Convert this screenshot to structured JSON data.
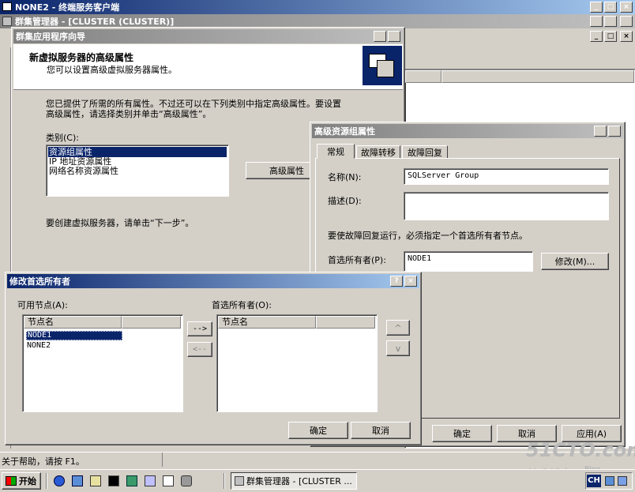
{
  "outer_window": {
    "title": "NONE2 - 终端服务客户端"
  },
  "cluster_admin": {
    "title": "群集管理器 - [CLUSTER (CLUSTER)]"
  },
  "wizard": {
    "title": "群集应用程序向导",
    "heading": "新虚拟服务器的高级属性",
    "subheading": "您可以设置高级虚拟服务器属性。",
    "intro_line1": "您已提供了所需的所有属性。不过还可以在下列类别中指定高级属性。要设置",
    "intro_line2": "高级属性，请选择类别并单击“高级属性”。",
    "category_label": "类别(C):",
    "categories": [
      "资源组属性",
      "IP 地址资源属性",
      "网络名称资源属性"
    ],
    "advanced_button": "高级属性",
    "footer_text": "要创建虚拟服务器，请单击“下一步”。"
  },
  "group_props": {
    "title": "高级资源组属性",
    "tabs": [
      "常规",
      "故障转移",
      "故障回复"
    ],
    "name_label": "名称(N):",
    "name_value": "SQLServer Group",
    "desc_label": "描述(D):",
    "desc_value": "",
    "owner_note": "要使故障回复运行，必须指定一个首选所有者节点。",
    "pref_owner_label": "首选所有者(P):",
    "pref_owner_value": "NODE1",
    "modify_button": "修改(M)...",
    "ok_button": "确定",
    "cancel_button": "取消",
    "apply_button": "应用(A)"
  },
  "modify_dialog": {
    "title": "修改首选所有者",
    "available_label": "可用节点(A):",
    "preferred_label": "首选所有者(O):",
    "column_header": "节点名",
    "available_nodes": [
      "NODE1",
      "NONE2"
    ],
    "preferred_nodes": [],
    "add_button": "-->",
    "remove_button": "<--",
    "up_button": "^",
    "down_button": "v",
    "ok_button": "确定",
    "cancel_button": "取消"
  },
  "statusbar": {
    "text": "关于帮助，请按 F1。"
  },
  "taskbar": {
    "start_label": "开始",
    "task_button": "群集管理器 - [CLUSTER ...",
    "ime_label": "CH"
  },
  "watermark": {
    "site": "51CTO.com",
    "blog": "技术博客",
    "blog_suffix": "Blog"
  },
  "title_buttons": {
    "minimize": "_",
    "maximize": "□",
    "close": "×",
    "help": "?"
  }
}
